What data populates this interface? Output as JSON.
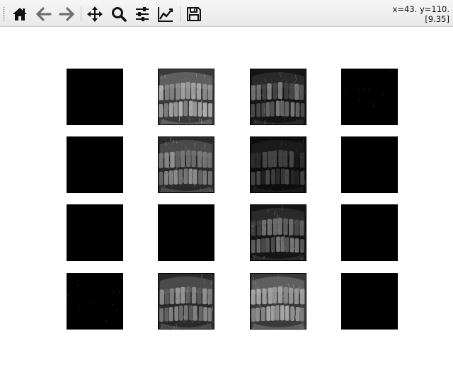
{
  "toolbar": {
    "buttons": [
      {
        "name": "home-button",
        "icon": "home-icon"
      },
      {
        "name": "back-button",
        "icon": "arrow-left-icon"
      },
      {
        "name": "forward-button",
        "icon": "arrow-right-icon"
      },
      {
        "name": "pan-button",
        "icon": "move-icon"
      },
      {
        "name": "zoom-button",
        "icon": "zoom-icon"
      },
      {
        "name": "configure-subplots-button",
        "icon": "sliders-icon"
      },
      {
        "name": "edit-axes-button",
        "icon": "line-chart-icon"
      },
      {
        "name": "save-button",
        "icon": "save-icon"
      }
    ],
    "coords_line1": "x=43. y=110.",
    "coords_line2": "[9.35]"
  },
  "figure": {
    "rows": 4,
    "cols": 4,
    "panels": [
      {
        "row": 0,
        "col": 0,
        "content": "black"
      },
      {
        "row": 0,
        "col": 1,
        "content": "bright"
      },
      {
        "row": 0,
        "col": 2,
        "content": "medium"
      },
      {
        "row": 0,
        "col": 3,
        "content": "sparse"
      },
      {
        "row": 1,
        "col": 0,
        "content": "black"
      },
      {
        "row": 1,
        "col": 1,
        "content": "medium-bright"
      },
      {
        "row": 1,
        "col": 2,
        "content": "dark"
      },
      {
        "row": 1,
        "col": 3,
        "content": "black"
      },
      {
        "row": 2,
        "col": 0,
        "content": "black"
      },
      {
        "row": 2,
        "col": 1,
        "content": "black"
      },
      {
        "row": 2,
        "col": 2,
        "content": "medium"
      },
      {
        "row": 2,
        "col": 3,
        "content": "black"
      },
      {
        "row": 3,
        "col": 0,
        "content": "sparse"
      },
      {
        "row": 3,
        "col": 1,
        "content": "medium-bright"
      },
      {
        "row": 3,
        "col": 2,
        "content": "bright"
      },
      {
        "row": 3,
        "col": 3,
        "content": "black"
      }
    ]
  }
}
